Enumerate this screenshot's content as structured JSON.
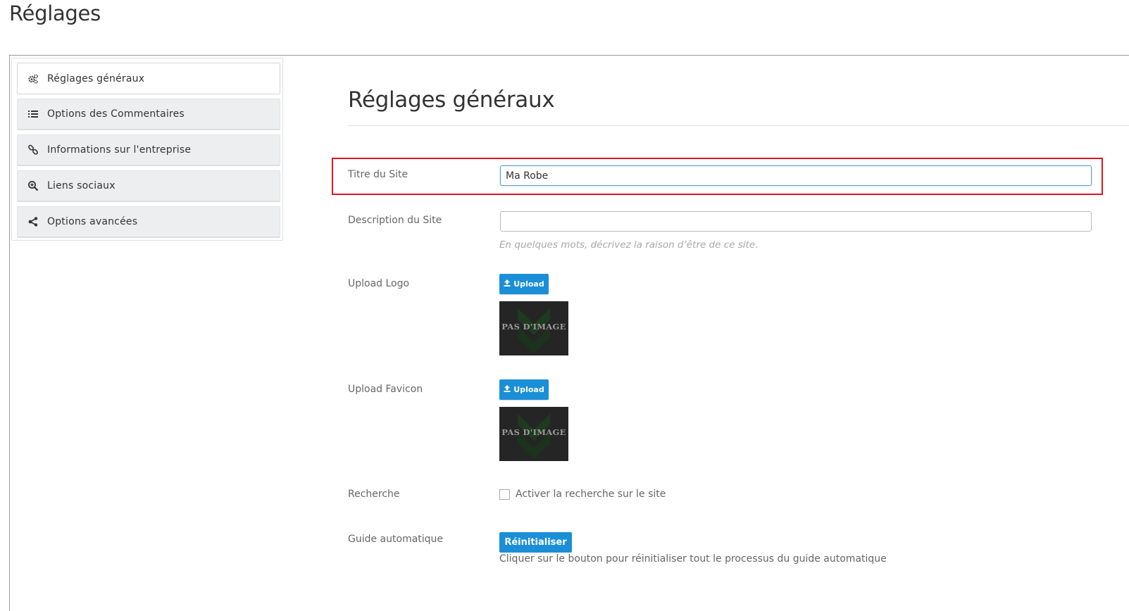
{
  "page": {
    "title": "Réglages"
  },
  "sidebar": {
    "items": [
      {
        "label": "Réglages généraux",
        "icon": "gears-icon",
        "active": true
      },
      {
        "label": "Options des Commentaires",
        "icon": "list-icon",
        "active": false
      },
      {
        "label": "Informations sur l'entreprise",
        "icon": "link-icon",
        "active": false
      },
      {
        "label": "Liens sociaux",
        "icon": "zoom-in-icon",
        "active": false
      },
      {
        "label": "Options avancées",
        "icon": "share-icon",
        "active": false
      }
    ]
  },
  "main": {
    "section_title": "Réglages généraux",
    "site_title": {
      "label": "Titre du Site",
      "value": "Ma Robe"
    },
    "site_description": {
      "label": "Description du Site",
      "value": "",
      "help": "En quelques mots, décrivez la raison d’être de ce site."
    },
    "logo": {
      "label": "Upload Logo",
      "button": "Upload",
      "placeholder_text": "PAS D'IMAGE"
    },
    "favicon": {
      "label": "Upload Favicon",
      "button": "Upload",
      "placeholder_text": "PAS D'IMAGE"
    },
    "search": {
      "label": "Recherche",
      "checkbox_label": "Activer la recherche sur le site",
      "checked": false
    },
    "guide": {
      "label": "Guide automatique",
      "button": "Réinitialiser",
      "help": "Cliquer sur le bouton pour réinitialiser tout le processus du guide automatique"
    }
  },
  "colors": {
    "accent": "#1a8fd8",
    "highlight": "#e0141e",
    "tab_background": "#eceeef",
    "thumbnail_background": "#252525"
  }
}
